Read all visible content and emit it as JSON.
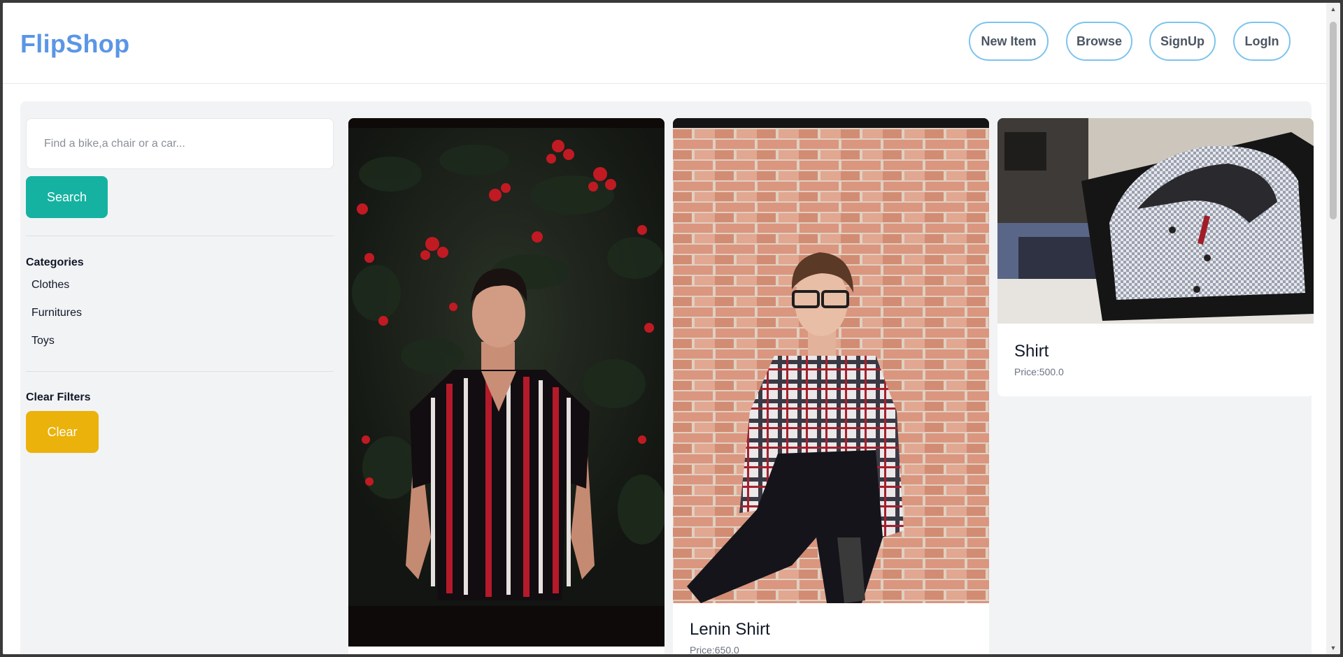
{
  "header": {
    "brand": "FlipShop",
    "nav": {
      "new_item": "New Item",
      "browse": "Browse",
      "signup": "SignUp",
      "login": "LogIn"
    }
  },
  "sidebar": {
    "search_placeholder": "Find a bike,a chair or a car...",
    "search_button": "Search",
    "categories_title": "Categories",
    "categories": [
      "Clothes",
      "Furnitures",
      "Toys"
    ],
    "clear_filters_title": "Clear Filters",
    "clear_button": "Clear"
  },
  "products": [
    {
      "title": "",
      "price": "",
      "image": "man in striped shirt in front of red flowers"
    },
    {
      "title": "Lenin Shirt",
      "price": "Price:650.0",
      "image": "man in plaid shirt leaning on brick wall"
    },
    {
      "title": "Shirt",
      "price": "Price:500.0",
      "image": "folded shirts in box"
    }
  ],
  "colors": {
    "brand": "#5a95e6",
    "nav_border": "#7cc4ef",
    "search_button": "#15b2a2",
    "clear_button": "#eab20a",
    "panel_bg": "#f2f3f5"
  }
}
